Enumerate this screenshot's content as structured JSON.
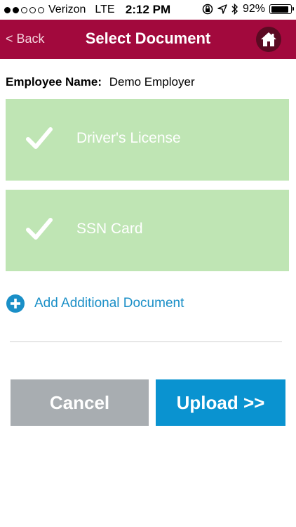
{
  "status_bar": {
    "carrier": "Verizon",
    "network": "LTE",
    "time": "2:12 PM",
    "battery": "92%",
    "battery_level": 0.92,
    "signal_filled": 2,
    "signal_total": 5
  },
  "nav": {
    "back_label": "< Back",
    "title": "Select Document",
    "home_icon": "home-icon"
  },
  "employee": {
    "label": "Employee Name:",
    "value": "Demo Employer"
  },
  "documents": [
    {
      "label": "Driver's License",
      "checked": true
    },
    {
      "label": "SSN Card",
      "checked": true
    }
  ],
  "add_document_label": "Add Additional Document",
  "buttons": {
    "cancel": "Cancel",
    "upload": "Upload >>"
  },
  "colors": {
    "nav_bg": "#a2093d",
    "card_bg": "#bfe5b4",
    "link": "#1a8fc7",
    "cancel_bg": "#a8adb1",
    "upload_bg": "#0a93d0"
  }
}
